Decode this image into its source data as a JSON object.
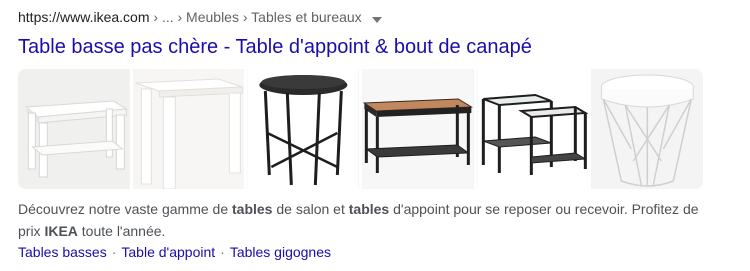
{
  "result": {
    "breadcrumb": {
      "domain": "https://www.ikea.com",
      "path": " › ... › Meubles › Tables et bureaux",
      "caret_icon": "caret-down-icon"
    },
    "title": "Table basse pas chère - Table d'appoint & bout de canapé",
    "images": [
      {
        "alt_icon": "white-coffee-table-with-shelf"
      },
      {
        "alt_icon": "white-side-table"
      },
      {
        "alt_icon": "black-tray-table"
      },
      {
        "alt_icon": "wood-top-coffee-table"
      },
      {
        "alt_icon": "glass-nesting-tables"
      },
      {
        "alt_icon": "white-wire-storage-table"
      }
    ],
    "snippet": {
      "part1": "Découvrez notre vaste gamme de ",
      "bold1": "tables",
      "part2": " de salon et ",
      "bold2": "tables",
      "part3": " d'appoint pour se reposer ou recevoir. Profitez de prix ",
      "bold3": "IKEA",
      "part4": " toute l'année."
    },
    "sitelinks": [
      "Tables basses",
      "Table d'appoint",
      "Tables gigognes"
    ],
    "separator": "·",
    "colors": {
      "link": "#1a0dab",
      "text": "#4d5156",
      "url": "#202124",
      "crumbs": "#5f6368"
    }
  }
}
